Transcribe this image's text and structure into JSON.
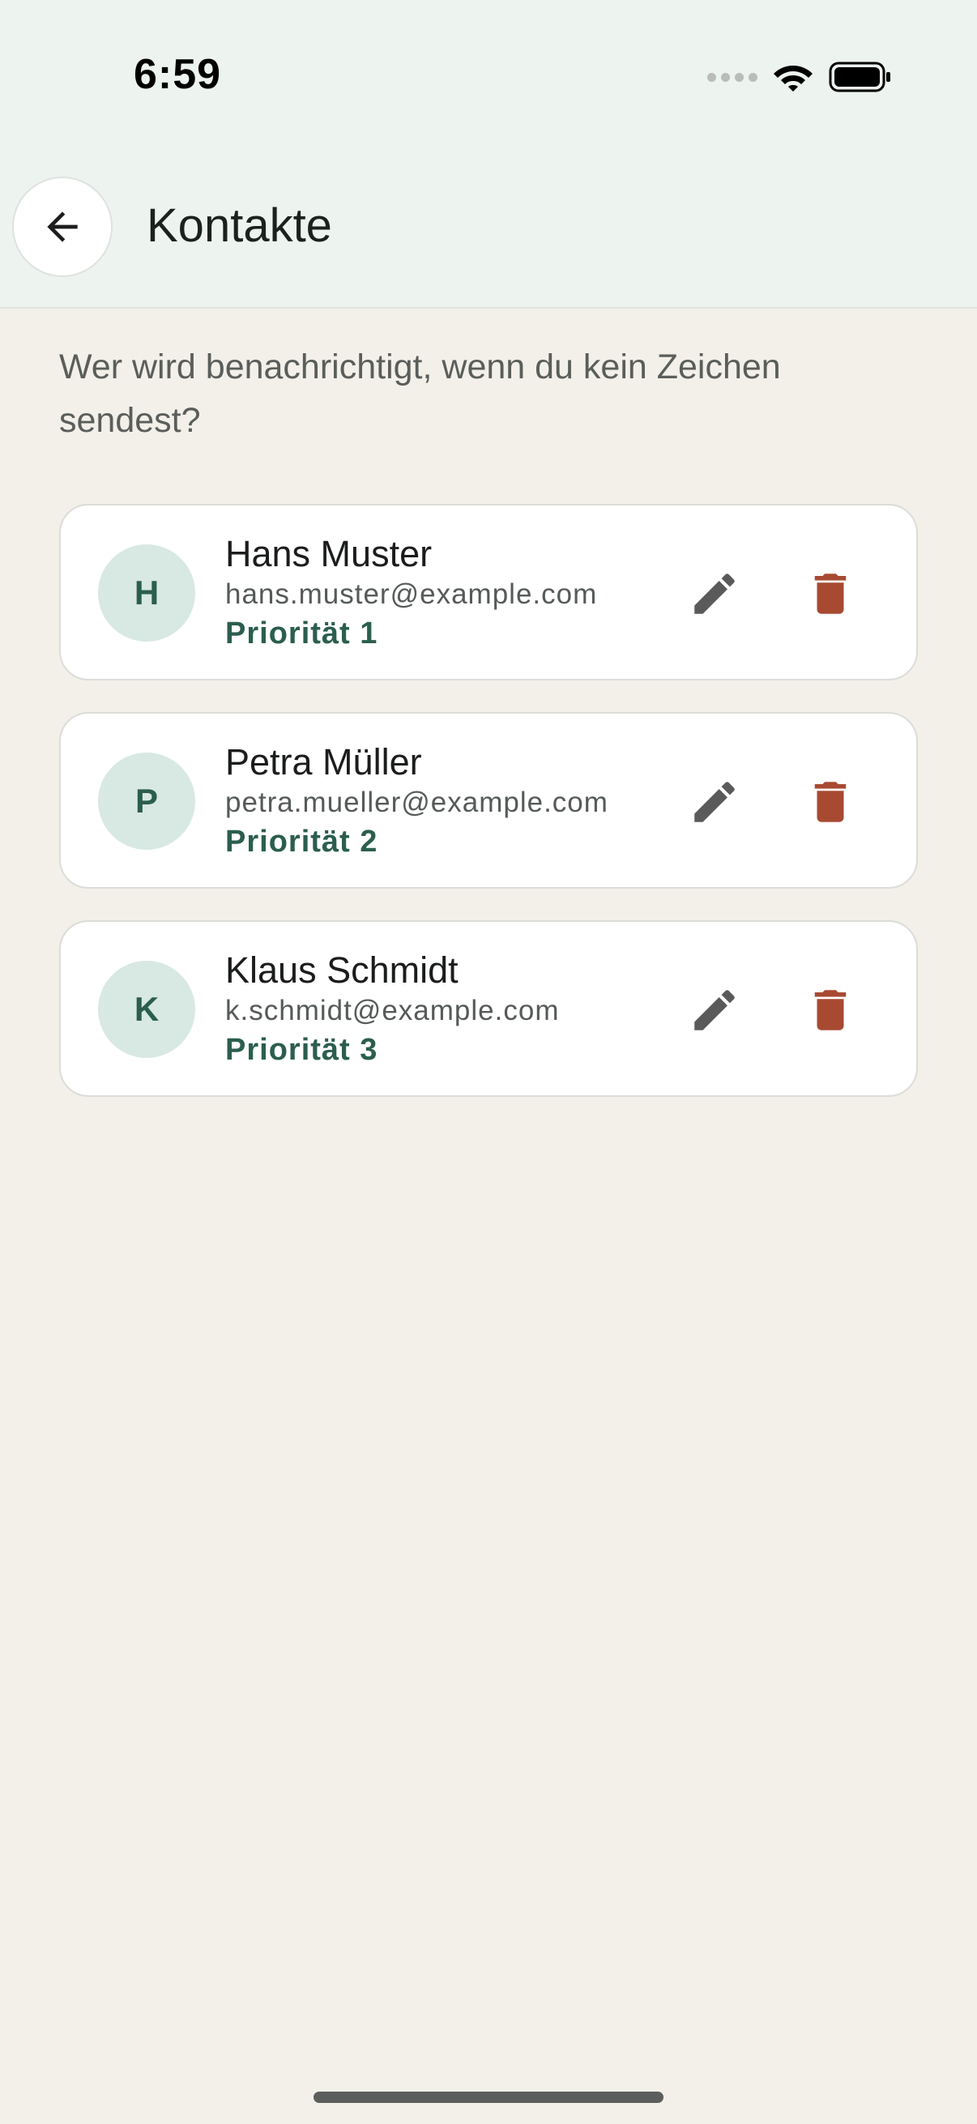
{
  "status_bar": {
    "time": "6:59"
  },
  "header": {
    "title": "Kontakte",
    "back_icon": "arrow-left-icon"
  },
  "intro": {
    "text": "Wer wird benachrichtigt, wenn du kein Zeichen sendest?"
  },
  "contacts": [
    {
      "initial": "H",
      "name": "Hans Muster",
      "email": "hans.muster@example.com",
      "priority": "Priorität 1"
    },
    {
      "initial": "P",
      "name": "Petra Müller",
      "email": "petra.mueller@example.com",
      "priority": "Priorität 2"
    },
    {
      "initial": "K",
      "name": "Klaus Schmidt",
      "email": "k.schmidt@example.com",
      "priority": "Priorität 3"
    }
  ],
  "colors": {
    "accent": "#2b5e4f",
    "delete": "#a84a32",
    "edit": "#5a5a5a",
    "avatar_bg": "#d8e8e2",
    "background": "#f3f0e9",
    "header_bg": "#edf3ee"
  }
}
